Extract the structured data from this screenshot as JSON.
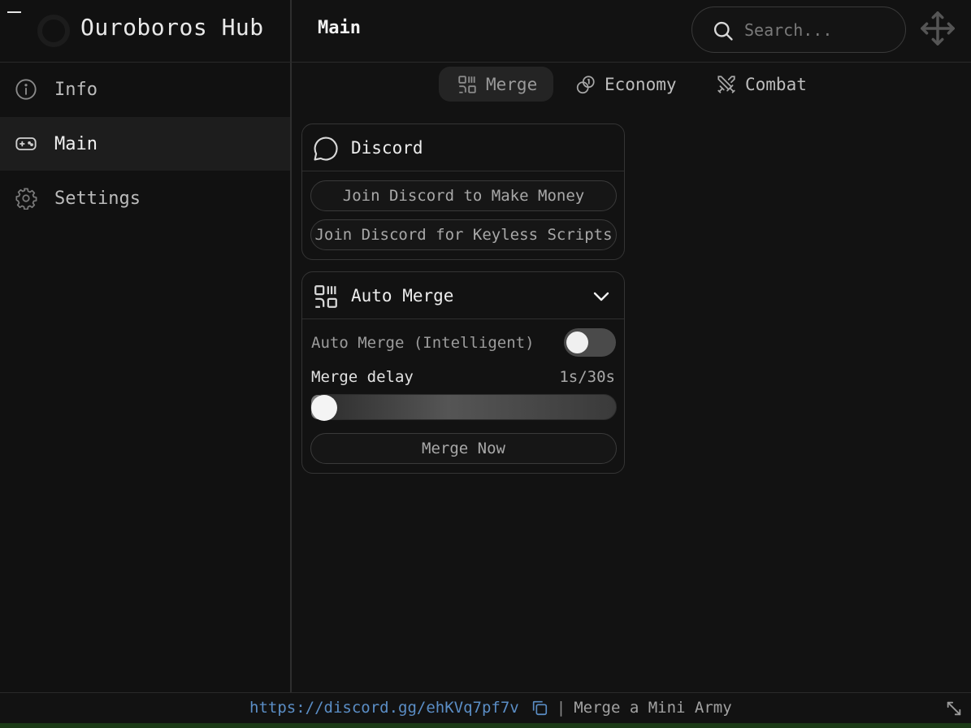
{
  "app": {
    "title": "Ouroboros Hub",
    "page_title": "Main"
  },
  "sidebar": {
    "items": [
      {
        "label": "Info",
        "icon": "info-icon",
        "active": false
      },
      {
        "label": "Main",
        "icon": "gamepad-icon",
        "active": true
      },
      {
        "label": "Settings",
        "icon": "gear-icon",
        "active": false
      }
    ]
  },
  "search": {
    "placeholder": "Search...",
    "value": ""
  },
  "tabs": [
    {
      "label": "Merge",
      "icon": "merge-icon",
      "active": true
    },
    {
      "label": "Economy",
      "icon": "coins-icon",
      "active": false
    },
    {
      "label": "Combat",
      "icon": "swords-icon",
      "active": false
    }
  ],
  "discord_card": {
    "title": "Discord",
    "icon": "chat-bubble-icon",
    "buttons": [
      "Join Discord to Make Money",
      "Join Discord for Keyless Scripts"
    ]
  },
  "auto_merge_card": {
    "title": "Auto Merge",
    "icon": "merge-icon",
    "toggle_label": "Auto Merge (Intelligent)",
    "toggle_on": false,
    "slider_label": "Merge delay",
    "slider_value_text": "1s/30s",
    "slider_value": 1,
    "slider_max": 30,
    "button_label": "Merge Now"
  },
  "footer": {
    "link": "https://discord.gg/ehKVq7pf7v",
    "separator": "|",
    "game_name": "Merge a Mini Army"
  },
  "colors": {
    "background": "#121212",
    "active_nav": "#1d1d1d",
    "link": "#5b8ec6",
    "accent_strip": "#1b3a16"
  }
}
